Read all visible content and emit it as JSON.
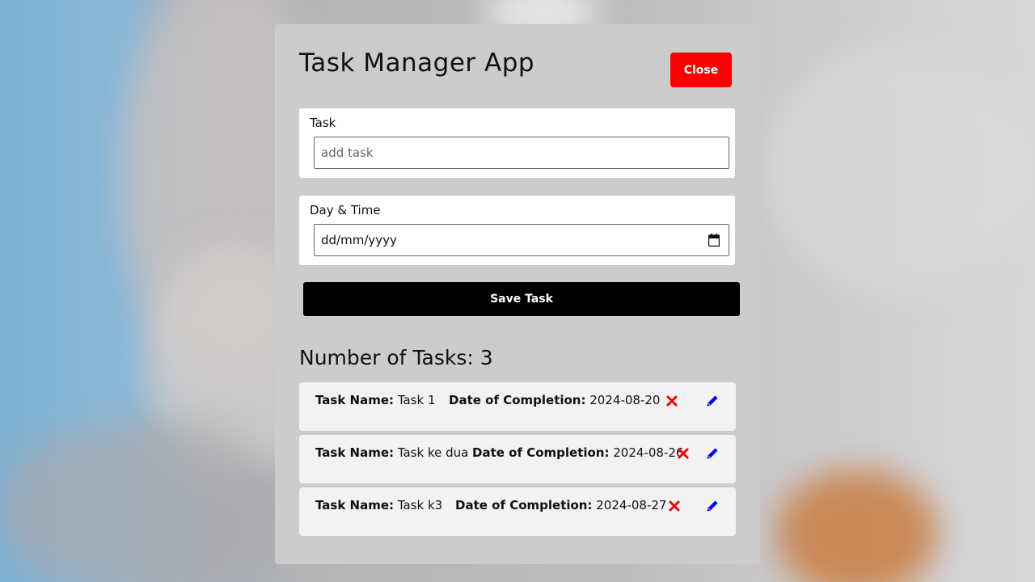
{
  "app": {
    "title": "Task Manager App",
    "close_label": "Close"
  },
  "form": {
    "task_label": "Task",
    "task_placeholder": "add task",
    "task_value": "",
    "datetime_label": "Day & Time",
    "datetime_value": "dd/mm/yyyy",
    "save_label": "Save Task"
  },
  "tasks": {
    "count_heading": "Number of Tasks: 3",
    "name_label": "Task Name:",
    "date_label": "Date of Completion:",
    "items": [
      {
        "name": "Task 1",
        "date": "2024-08-20"
      },
      {
        "name": "Task ke dua",
        "date": "2024-08-26"
      },
      {
        "name": "Task k3",
        "date": "2024-08-27"
      }
    ]
  },
  "colors": {
    "close_button": "#ff0000",
    "save_button": "#000000",
    "delete_icon": "#ff0000",
    "edit_icon": "#0000ff",
    "card_background": "#cccccc"
  },
  "icons": {
    "delete": "x-icon",
    "edit": "pencil-icon",
    "calendar": "calendar-icon"
  }
}
